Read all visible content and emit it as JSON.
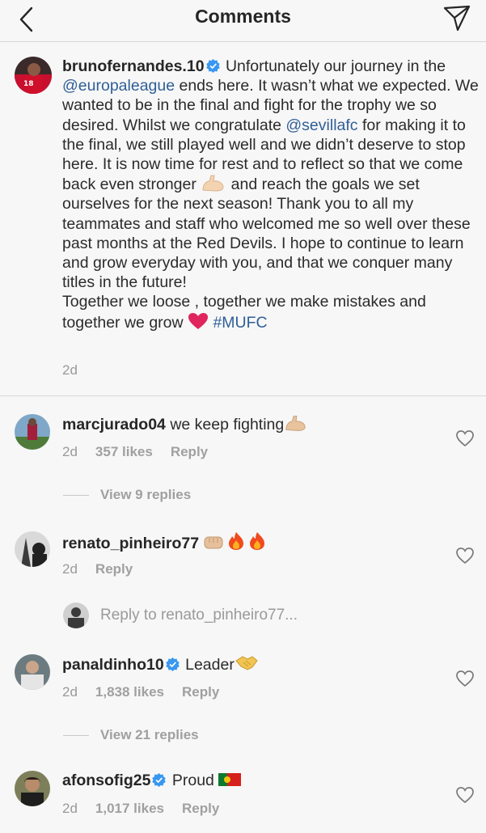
{
  "header": {
    "title": "Comments"
  },
  "caption": {
    "username": "brunofernandes.10",
    "verified": true,
    "text_a": " Unfortunately our journey in the ",
    "mention_a": "@europaleague",
    "text_b": " ends here. It wasn’t what we expected. We wanted to be in the final and fight for the trophy we so desired. Whilst we congratulate ",
    "mention_b": "@sevillafc",
    "text_c": " for making it to the final, we still played well and we didn’t deserve to stop here. It is now time for rest and to reflect so that we come back even stronger ",
    "emoji_a": "flexed-biceps",
    "text_d": " and reach the goals we set ourselves for the next season! Thank you to all my teammates and staff who welcomed me so well over these past months at the Red Devils. I hope to continue to learn and grow everyday with you, and that we conquer many titles in the future!",
    "text_e": "Together we loose , together we make mistakes and together we grow ",
    "emoji_b": "red-heart",
    "hashtag": "#MUFC",
    "time": "2d"
  },
  "comments": [
    {
      "username": "marcjurado04",
      "verified": false,
      "text": " we keep fighting",
      "emojis": [
        "flexed-biceps"
      ],
      "time": "2d",
      "likes": "357 likes",
      "reply": "Reply",
      "view_replies": "View 9 replies"
    },
    {
      "username": "renato_pinheiro77",
      "verified": false,
      "text": " ",
      "emojis": [
        "oncoming-fist",
        "fire",
        "fire"
      ],
      "time": "2d",
      "likes": "",
      "reply": "Reply",
      "reply_to": "Reply to renato_pinheiro77..."
    },
    {
      "username": "panaldinho10",
      "verified": true,
      "text": " Leader",
      "emojis": [
        "handshake"
      ],
      "time": "2d",
      "likes": "1,838 likes",
      "reply": "Reply",
      "view_replies": "View 21 replies"
    },
    {
      "username": "afonsofig25",
      "verified": true,
      "text": " Proud ",
      "emojis": [
        "portugal-flag"
      ],
      "time": "2d",
      "likes": "1,017 likes",
      "reply": "Reply"
    }
  ],
  "colors": {
    "link": "#2f5f97",
    "verified": "#3897f0",
    "muted": "#9a9a9a",
    "heart_emoji": "#e0245e"
  }
}
